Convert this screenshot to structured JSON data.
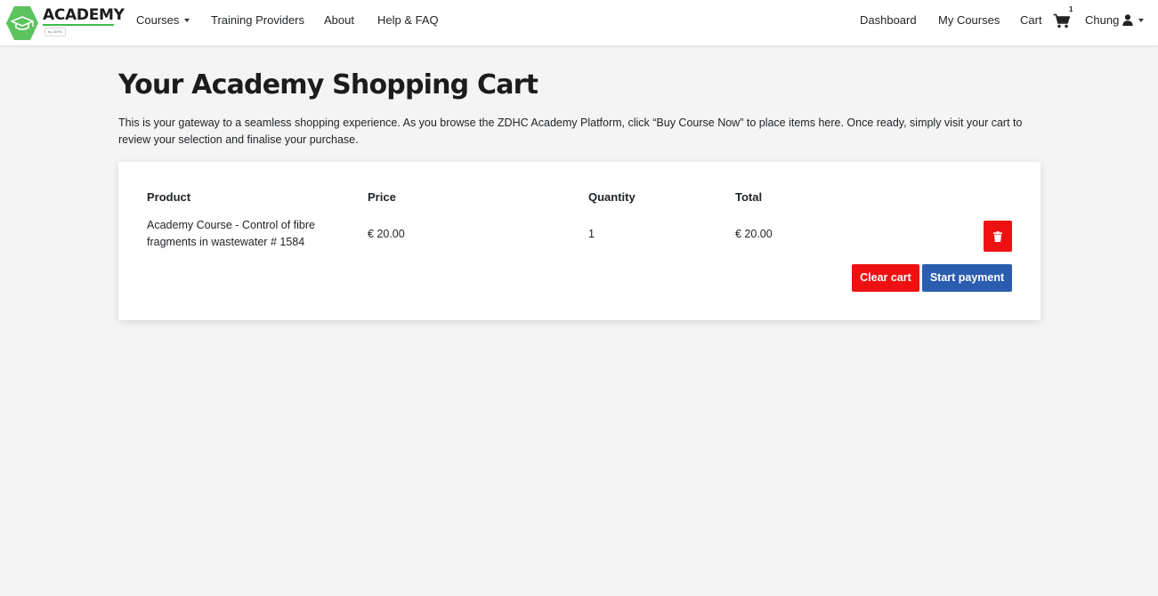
{
  "brand": {
    "name": "ACADEMY",
    "sub": "by ZDHC",
    "hex_color": "#5cc45f",
    "line_color": "#3cbf4a"
  },
  "nav": {
    "left": [
      {
        "label": "Courses",
        "dropdown": true
      },
      {
        "label": "Training Providers"
      },
      {
        "label": "About"
      },
      {
        "label": "Help & FAQ"
      }
    ],
    "right": [
      {
        "label": "Dashboard"
      },
      {
        "label": "My Courses"
      },
      {
        "label": "Cart"
      }
    ],
    "cart_count": "1",
    "user": "Chung",
    "icons": [
      "chevron-down-icon",
      "cart-icon",
      "user-icon"
    ]
  },
  "page": {
    "title": "Your Academy Shopping Cart",
    "intro": "This is your gateway to a seamless shopping experience. As you browse the ZDHC Academy Platform, click “Buy Course Now” to place items here. Once ready, simply visit your cart to review your selection and finalise your purchase."
  },
  "cart": {
    "headers": {
      "product": "Product",
      "price": "Price",
      "quantity": "Quantity",
      "total": "Total"
    },
    "items": [
      {
        "product_line1": "Academy Course - Control of fibre",
        "product_line2": "fragments in wastewater # 1584",
        "price": "€ 20.00",
        "quantity": "1",
        "total": "€ 20.00",
        "remove_icon": "trash-icon"
      }
    ],
    "clear_label": "Clear cart",
    "pay_label": "Start payment",
    "colors": {
      "danger": "#ef1111",
      "primary": "#2a5db0"
    }
  }
}
